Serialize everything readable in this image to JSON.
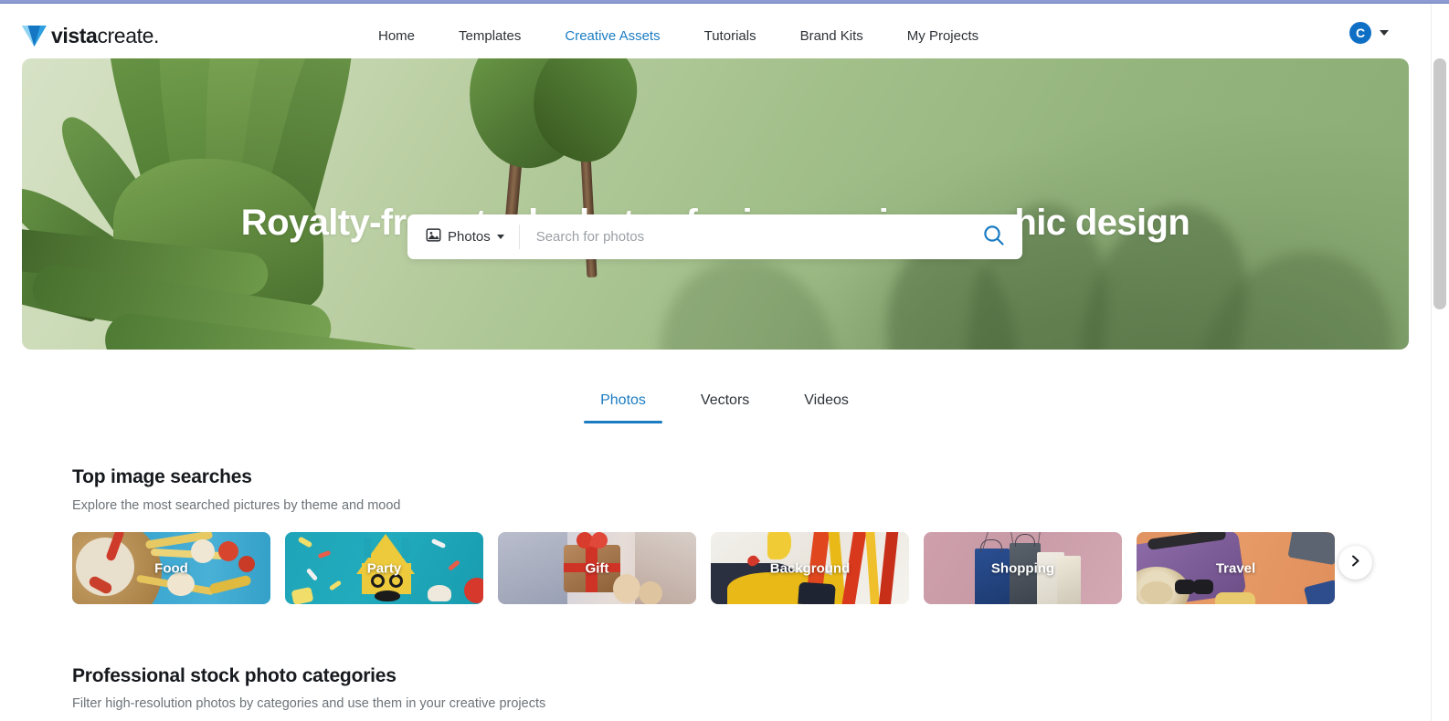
{
  "brand": {
    "name_bold": "vista",
    "name_light": "create",
    "dot": ".",
    "logo_icon": "vista-triangle-logo"
  },
  "nav": {
    "links": [
      {
        "label": "Home",
        "active": false
      },
      {
        "label": "Templates",
        "active": false
      },
      {
        "label": "Creative Assets",
        "active": true
      },
      {
        "label": "Tutorials",
        "active": false
      },
      {
        "label": "Brand Kits",
        "active": false
      },
      {
        "label": "My Projects",
        "active": false
      }
    ],
    "avatar_initial": "C",
    "avatar_color": "#0f6fc5",
    "caret_icon": "chevron-down-icon"
  },
  "hero": {
    "title": "Royalty-free stock photos for impressive graphic design",
    "background_description": "tropical-leaf-photo"
  },
  "search": {
    "type_label": "Photos",
    "type_icon": "image-icon",
    "dropdown_icon": "chevron-down-icon",
    "placeholder": "Search for photos",
    "value": "",
    "submit_icon": "search-icon",
    "accent": "#1b7cc2"
  },
  "asset_tabs": [
    {
      "label": "Photos",
      "active": true
    },
    {
      "label": "Vectors",
      "active": false
    },
    {
      "label": "Videos",
      "active": false
    }
  ],
  "top_searches": {
    "title": "Top image searches",
    "subtitle": "Explore the most searched pictures by theme and mood",
    "next_icon": "chevron-right-icon",
    "cards": [
      {
        "label": "Food"
      },
      {
        "label": "Party"
      },
      {
        "label": "Gift"
      },
      {
        "label": "Background"
      },
      {
        "label": "Shopping"
      },
      {
        "label": "Travel"
      }
    ]
  },
  "categories_section": {
    "title": "Professional stock photo categories",
    "subtitle": "Filter high-resolution photos by categories and use them in your creative projects"
  }
}
